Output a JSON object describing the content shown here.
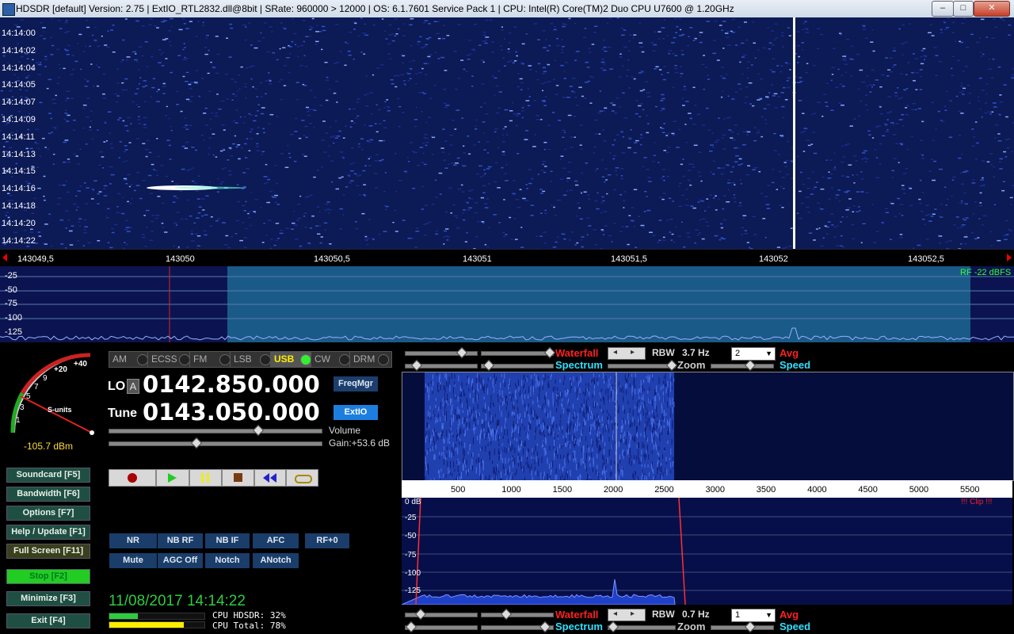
{
  "window": {
    "title": "HDSDR  [default]  Version: 2.75   |  ExtIO_RTL2832.dll@8bit  |  SRate: 960000 > 12000  |  OS: 6.1.7601  Service Pack 1  |  CPU: Intel(R) Core(TM)2 Duo CPU     U7600  @ 1.20GHz",
    "minimize": "–",
    "maximize": "□",
    "close": "✕"
  },
  "waterfall": {
    "timestamps": [
      "14:14:00",
      "14:14:02",
      "14:14:04",
      "14:14:05",
      "14:14:07",
      "14:14:09",
      "14:14:11",
      "14:14:13",
      "14:14:15",
      "14:14:16",
      "14:14:18",
      "14:14:20",
      "14:14:22"
    ]
  },
  "freq_scale": {
    "labels": [
      "143049,5",
      "143050",
      "143050,5",
      "143051",
      "143051,5",
      "143052",
      "143052,5"
    ]
  },
  "spectrum": {
    "db_labels": [
      "-25",
      "-50",
      "-75",
      "-100",
      "-125"
    ],
    "rf_label": "RF -22 dBFS"
  },
  "smeter": {
    "scale": [
      "+40",
      "+20",
      "9",
      "7",
      "5",
      "3",
      "1"
    ],
    "units_label": "S-units",
    "reading": "-105.7 dBm"
  },
  "modes": [
    {
      "label": "AM",
      "active": false
    },
    {
      "label": "ECSS",
      "active": false
    },
    {
      "label": "FM",
      "active": false
    },
    {
      "label": "LSB",
      "active": false
    },
    {
      "label": "USB",
      "active": true
    },
    {
      "label": "CW",
      "active": false
    },
    {
      "label": "DRM",
      "active": false
    }
  ],
  "tuning": {
    "lo_label": "LO",
    "lo_button": "A",
    "lo_freq": "0142.850.000",
    "tune_label": "Tune",
    "tune_freq": "0143.050.000",
    "freqmgr": "FreqMgr",
    "extio": "ExtIO",
    "volume_label": "Volume",
    "gain_label": "Gain:+53.6 dB",
    "volume_level": 0.7,
    "gain_level": 0.41
  },
  "transport": [
    "record",
    "play",
    "pause",
    "stop",
    "rewind",
    "loop"
  ],
  "left_buttons": [
    {
      "label": "Soundcard  [F5]"
    },
    {
      "label": "Bandwidth  [F6]"
    },
    {
      "label": "Options   [F7]"
    },
    {
      "label": "Help / Update  [F1]"
    },
    {
      "label": "Full Screen  [F11]"
    },
    {
      "label": "Stop      [F2]",
      "active": true
    },
    {
      "label": "Minimize  [F3]"
    },
    {
      "label": "Exit      [F4]"
    }
  ],
  "dsp_buttons_row1": [
    "NR",
    "NB RF",
    "NB IF",
    "AFC",
    "RF+0"
  ],
  "dsp_buttons_row2": [
    "Mute",
    "AGC Off",
    "Notch",
    "ANotch"
  ],
  "status": {
    "datetime": "11/08/2017 14:14:22",
    "cpu_hdsdr": "CPU HDSDR: 32%",
    "cpu_total": "CPU Total: 78%",
    "cpu_hdsdr_level": 0.32,
    "cpu_total_level": 0.78
  },
  "rf_controls": {
    "waterfall": "Waterfall",
    "spectrum": "Spectrum",
    "rbw_label": "RBW",
    "rbw_value": "3.7 Hz",
    "zoom": "Zoom",
    "avg_select": "2",
    "avg": "Avg",
    "speed": "Speed"
  },
  "af_axis": {
    "labels": [
      "500",
      "1000",
      "1500",
      "2000",
      "2500",
      "3000",
      "3500",
      "4000",
      "4500",
      "5000",
      "5500"
    ],
    "db_labels": [
      "0 dB",
      "-25",
      "-50",
      "-75",
      "-100",
      "-125"
    ],
    "clip": "!!! Clip !!!"
  },
  "af_controls": {
    "waterfall": "Waterfall",
    "spectrum": "Spectrum",
    "rbw_label": "RBW",
    "rbw_value": "0.7 Hz",
    "zoom": "Zoom",
    "avg_select": "1",
    "avg": "Avg",
    "speed": "Speed"
  },
  "colors": {
    "waterfall_bg": "#0c1a55",
    "passband": "#1a5a88",
    "accent_red": "#ff2020",
    "accent_cyan": "#30e0ff",
    "status_green": "#2ecc40",
    "lcd_text": "#ffffff"
  }
}
